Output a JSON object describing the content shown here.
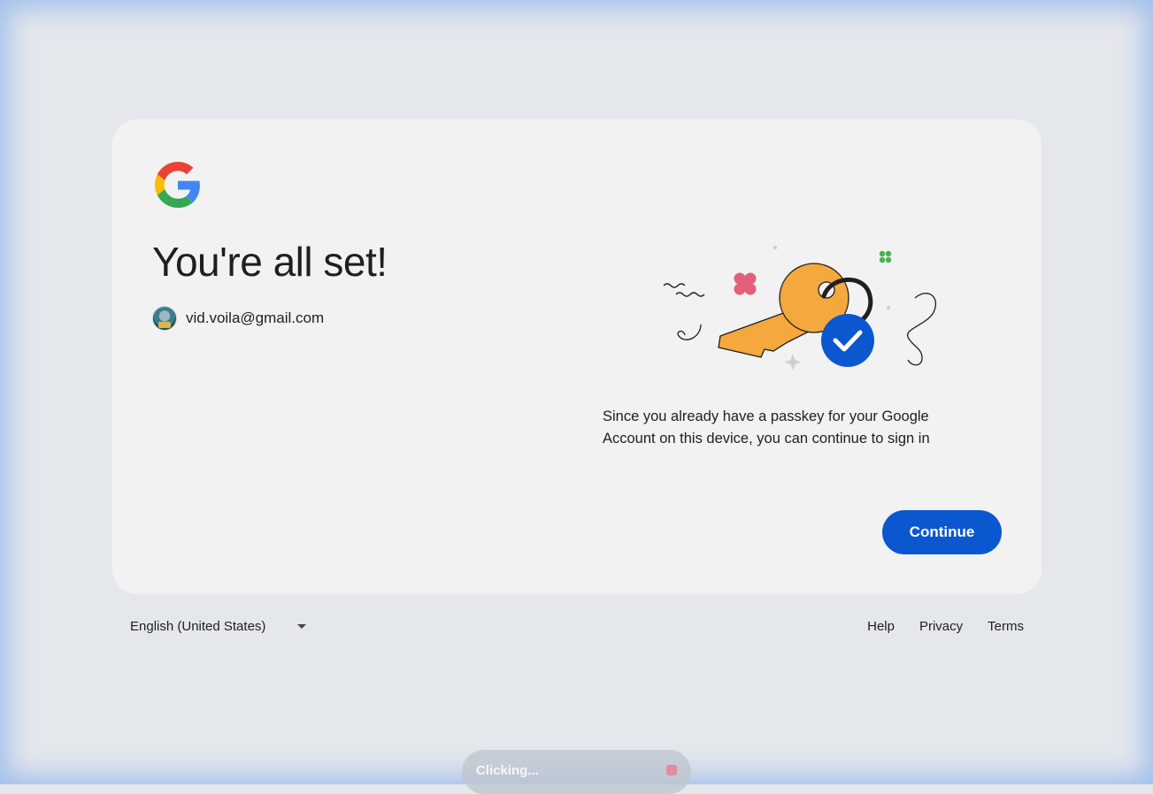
{
  "card": {
    "title": "You're all set!",
    "account_email": "vid.voila@gmail.com",
    "description": "Since you already have a passkey for your Google Account on this device, you can continue to sign in",
    "continue_label": "Continue"
  },
  "footer": {
    "language": "English (United States)",
    "links": [
      "Help",
      "Privacy",
      "Terms"
    ]
  },
  "toast": {
    "text": "Clicking..."
  },
  "icons": {
    "logo": "google-g-logo",
    "illustration": "passkey-key-illustration",
    "dropdown": "caret-down-icon",
    "stop": "stop-icon"
  },
  "colors": {
    "primary_button": "#0b57d0",
    "card_background": "#f2f2f2",
    "page_background": "#e4e7ec",
    "key": "#f4a83d",
    "check_badge": "#0b57d0"
  }
}
